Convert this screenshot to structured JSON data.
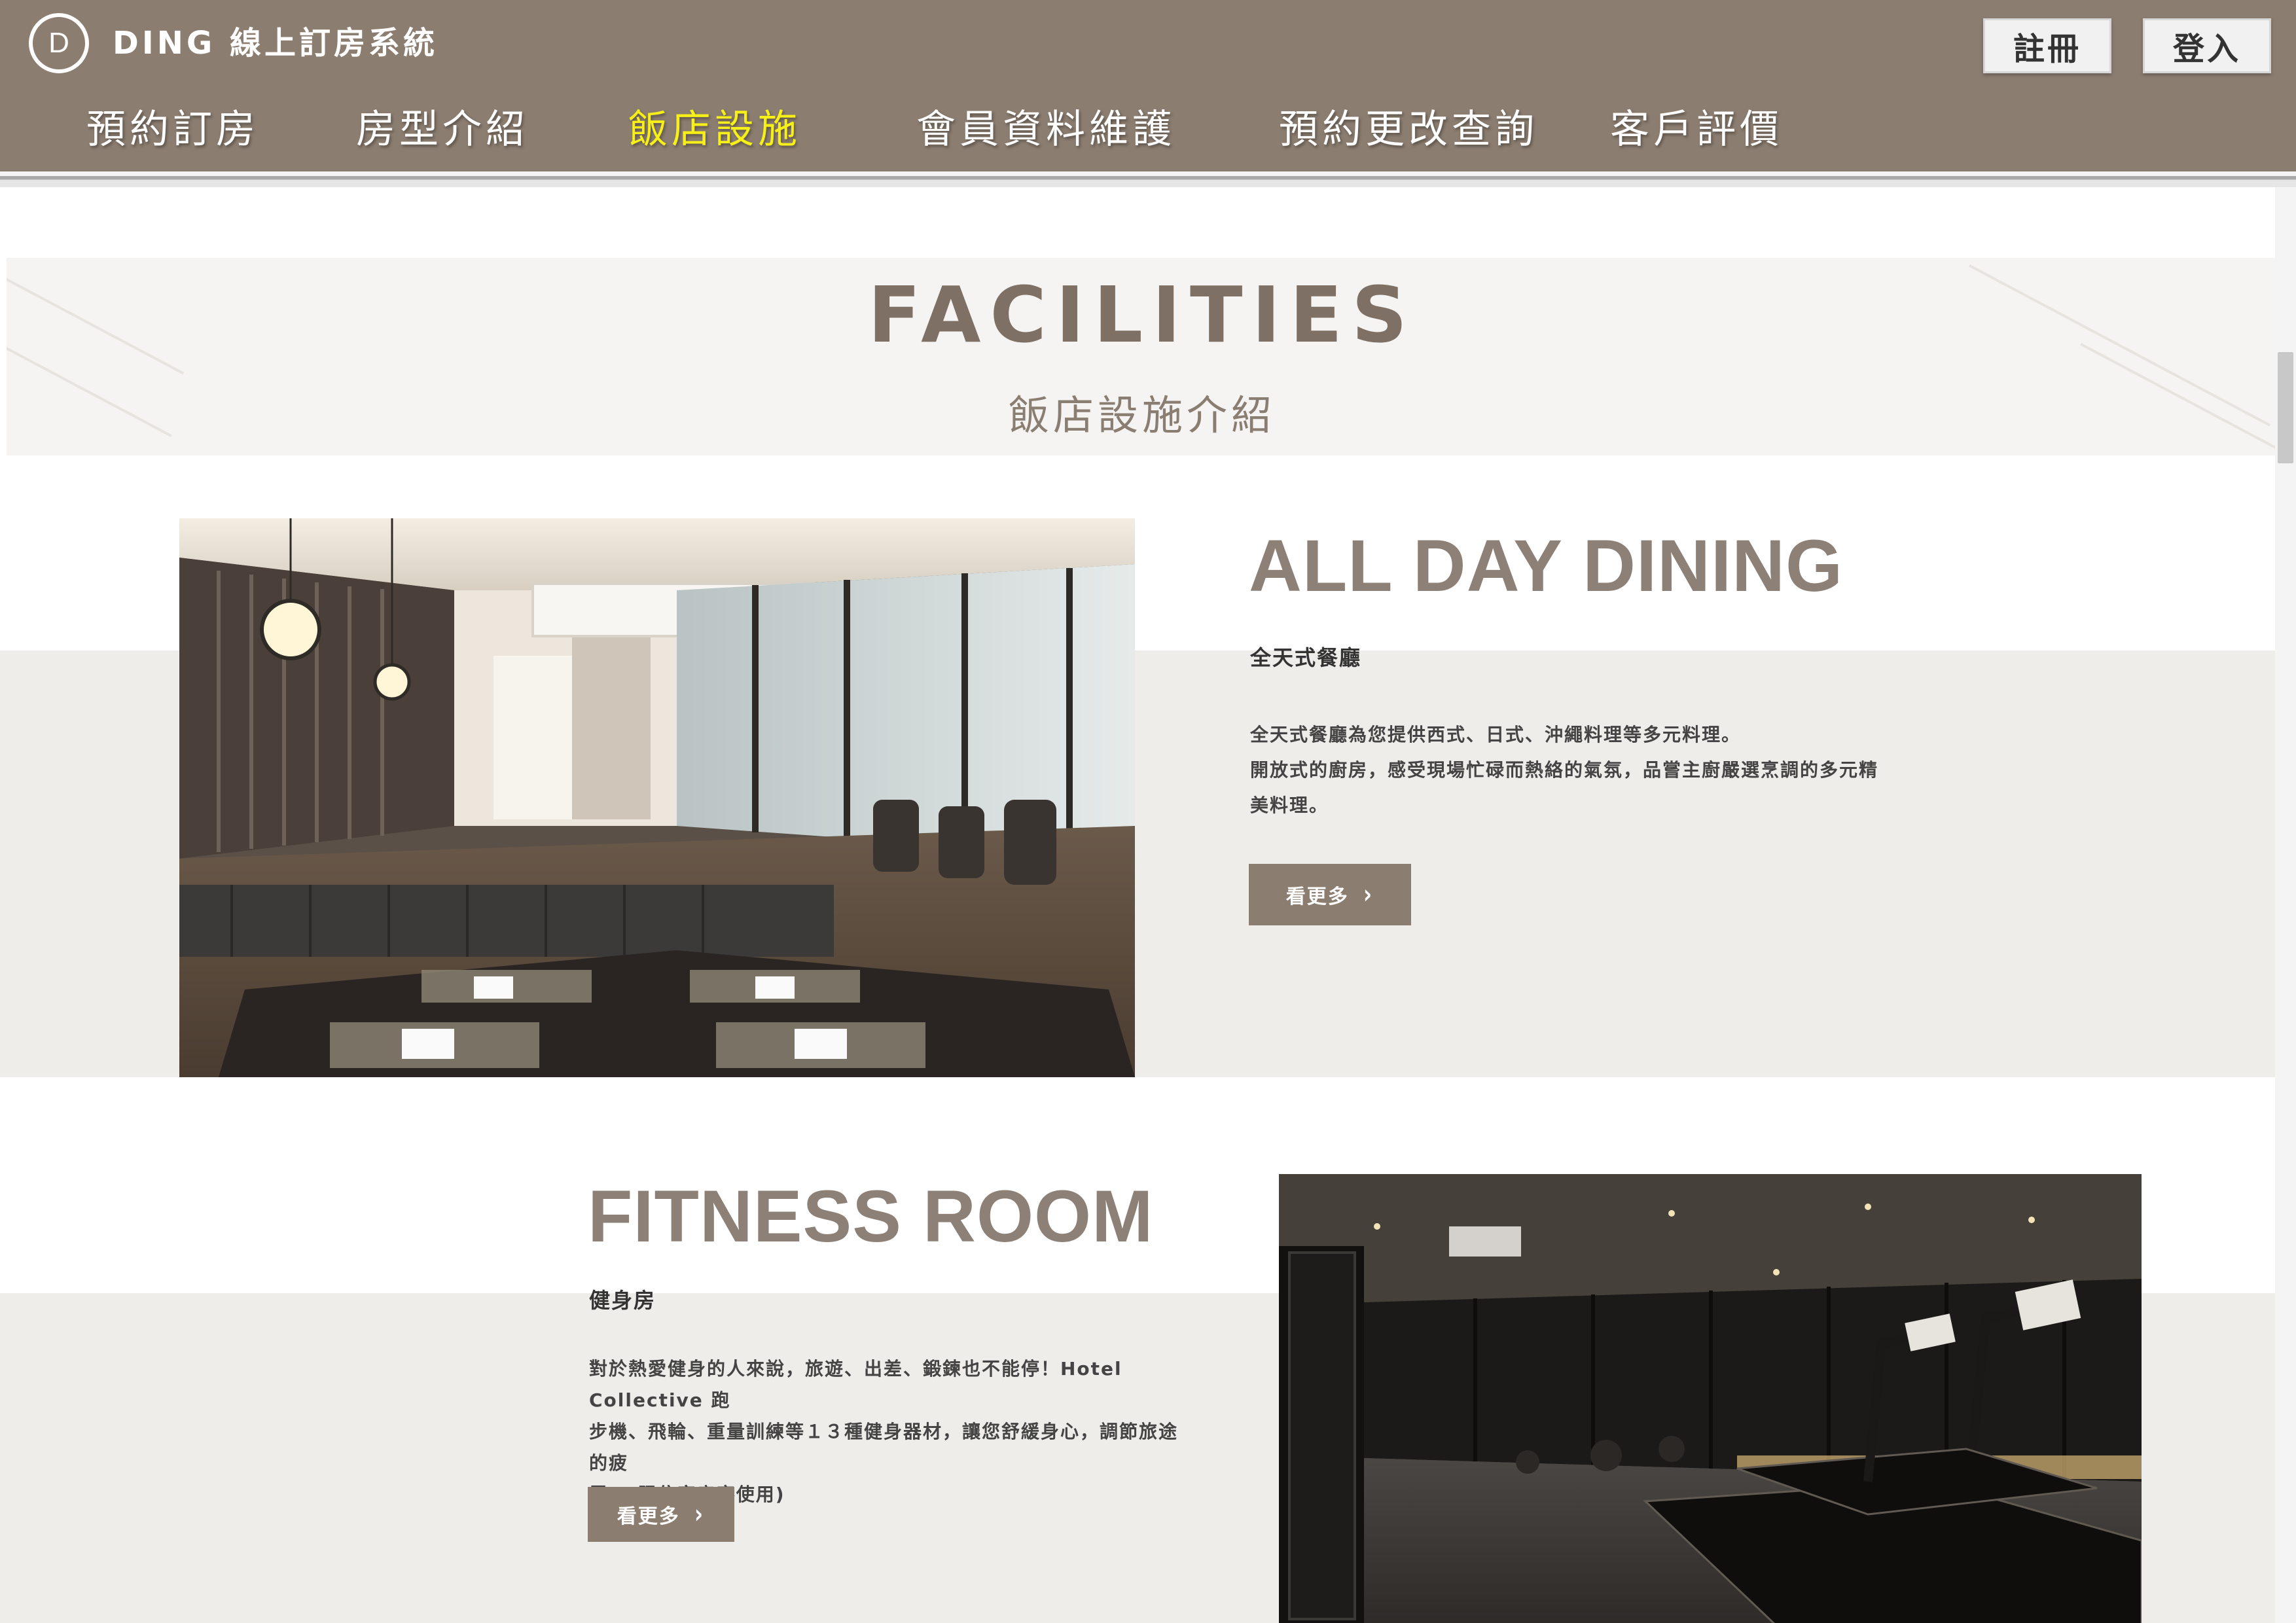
{
  "app": {
    "brand": "DING 線上訂房系統",
    "colors": {
      "header": "#8b7d70",
      "active_nav": "#f7f018",
      "band": "#efedea",
      "button": "#8b7d70"
    }
  },
  "header": {
    "logo_letter": "D",
    "register_label": "註冊",
    "login_label": "登入",
    "nav": [
      {
        "label": "預約訂房"
      },
      {
        "label": "房型介紹"
      },
      {
        "label": "飯店設施",
        "active": true
      },
      {
        "label": "會員資料維護"
      },
      {
        "label": "預約更改查詢"
      },
      {
        "label": "客戶評價"
      }
    ]
  },
  "facilities": {
    "title": "FACILITIES",
    "subtitle": "飯店設施介紹",
    "items": [
      {
        "title": "ALL DAY DINING",
        "subtitle": "全天式餐廳",
        "desc_lines": [
          "全天式餐廳為您提供西式、日式、沖繩料理等多元料理。",
          "開放式的廚房，感受現場忙碌而熱絡的氣氛，品嘗主廚嚴選烹調的多元精",
          "美料理。"
        ],
        "button": "看更多",
        "image": "restaurant-interior"
      },
      {
        "title": "FITNESS ROOM",
        "subtitle": "健身房",
        "desc_lines": [
          "對於熱愛健身的人來說，旅遊、出差、鍛鍊也不能停！Hotel Collective 跑",
          "步機、飛輪、重量訓練等１３種健身器材，讓您舒緩身心，調節旅途的疲",
          "累。(限住宿房客使用)"
        ],
        "button": "看更多",
        "image": "fitness-room"
      }
    ]
  }
}
